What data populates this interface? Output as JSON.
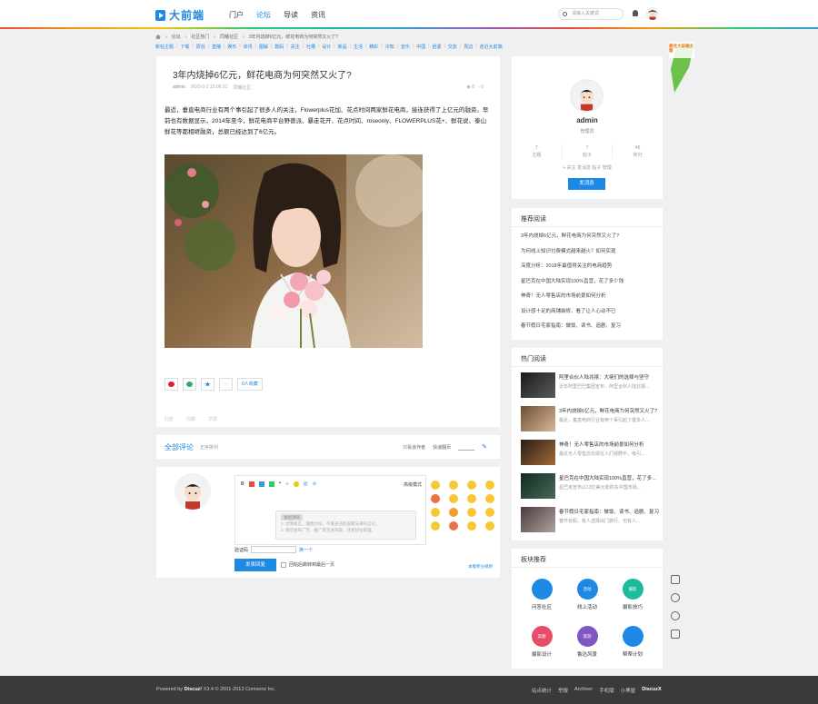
{
  "header": {
    "logo_text": "大前端",
    "nav": [
      "门户",
      "论坛",
      "导读",
      "资讯"
    ],
    "active_nav": 1,
    "search_placeholder": "请输入关键词"
  },
  "breadcrumb": [
    "论坛",
    "社区热门",
    "同曦社区",
    "3年内烧掉6亿元，鲜花电商为何突然又火了?"
  ],
  "quick_links": [
    "新帖主题",
    "下载",
    "原创",
    "直播",
    "娱乐",
    "资讯",
    "图解",
    "数码",
    "关注",
    "吐槽",
    "设计",
    "新品",
    "生活",
    "精彩",
    "冷知",
    "音乐",
    "中国",
    "赶紧",
    "交友",
    "周边",
    "走近大前端"
  ],
  "article": {
    "title": "3年内烧掉6亿元，鲜花电商为何突然又火了?",
    "author": "admin",
    "date": "2020-3-2 15:06:31",
    "board": "同曦社区",
    "views": "8",
    "replies": "0",
    "body": "最近，垂直电商行业有两个事引起了很多人的关注，Flowerplus花加、花点时间两家鲜花电商，接连获得了上亿元的融资。早前也有数据显示，2014年至今，鲜花电商平台野兽派、暴走花开、花点时间、roseonly、FLOWERPLUS花+、鲜花说、泰山鲜花等都相继融资，总额已经达到了6亿元。",
    "favorite_count": "0人收藏",
    "actions": [
      "回复",
      "收藏",
      "举报"
    ]
  },
  "comments": {
    "title": "全部评论",
    "subtitle": "正序排列",
    "only_author": "只看该作者",
    "jump_label": "快速翻页",
    "advanced": "高级模式",
    "tip_title": "发帖须知",
    "tip_lines": [
      "1. 文明发言，理性讨论，不发表违反国家法律的言论。",
      "2. 请勿发布广告、推广等无关内容，违者封号处理。"
    ],
    "vcode_label": "验证码",
    "vcode_change": "换一个",
    "submit": "发表回复",
    "agree": "回帖后跳转到最后一页",
    "rules": "本版积分规则"
  },
  "profile": {
    "name": "admin",
    "role": "管理员",
    "stats": [
      {
        "num": "7",
        "label": "主题"
      },
      {
        "num": "7",
        "label": "帖子"
      },
      {
        "num": "45",
        "label": "积分"
      }
    ],
    "links": "+ 关注  发消息  帖子  管理",
    "button": "发消息"
  },
  "recommended": {
    "title": "推荐阅读",
    "items": [
      "3年内烧掉6亿元，鲜花电商为何突然又火了?",
      "为何线上知识付费模式越来越火？如何实现",
      "深度分析：2018年最值得关注的电商趋势",
      "星巴克在中国大陆实现100%直营，花了多少钱",
      "神奇！无人零售店的市场前景如何分析",
      "设计感十足的商铺装修，看了让人心动不已",
      "春节假日宅家指南：做饭、读书、追剧、复习"
    ]
  },
  "hot": {
    "title": "热门阅读",
    "items": [
      {
        "title": "阿里合伙人陆兆禧：大佬们的选择与坚守",
        "sub": "近日阿里巴巴集团宣布：阿里合伙人陆兆禧..."
      },
      {
        "title": "3年内烧掉6亿元，鲜花电商为何突然又火了?",
        "sub": "最近，垂直电商行业有两个事引起了很多人..."
      },
      {
        "title": "神奇！无人零售店的市场前景如何分析",
        "sub": "最近无人零售店出现在人们视野中，吸引..."
      },
      {
        "title": "星巴克在中国大陆实现100%直营，花了多少钱",
        "sub": "星巴克宣布以13亿美元收购东中国市场..."
      },
      {
        "title": "春节假日宅家指南：做饭、读书、追剧、复习",
        "sub": "春节长假，有人选择出门旅行，也有人..."
      }
    ]
  },
  "boards": {
    "title": "板块推荐",
    "items": [
      {
        "label": "问答社区",
        "badge": "",
        "color": "#1e88e5"
      },
      {
        "label": "线上活动",
        "badge": "活动",
        "color": "#1e88e5"
      },
      {
        "label": "摄影技巧",
        "badge": "摄影",
        "color": "#1abc9c"
      },
      {
        "label": "摄影设计",
        "badge": "美图",
        "color": "#e74c6a"
      },
      {
        "label": "鲁达风景",
        "badge": "旅游",
        "color": "#7e57c2"
      },
      {
        "label": "帮帮计划",
        "badge": "",
        "color": "#1e88e5"
      }
    ]
  },
  "footer": {
    "powered": "Powered by",
    "brand": "Discuz!",
    "version": "X3.4  © 2001-2013",
    "company": "Comsenz Inc.",
    "links": [
      "站点统计",
      "举报",
      "Archiver",
      "手机版",
      "小黑屋"
    ],
    "last": "DiscuzX"
  },
  "ribbon_text": "最佳大前端主题"
}
